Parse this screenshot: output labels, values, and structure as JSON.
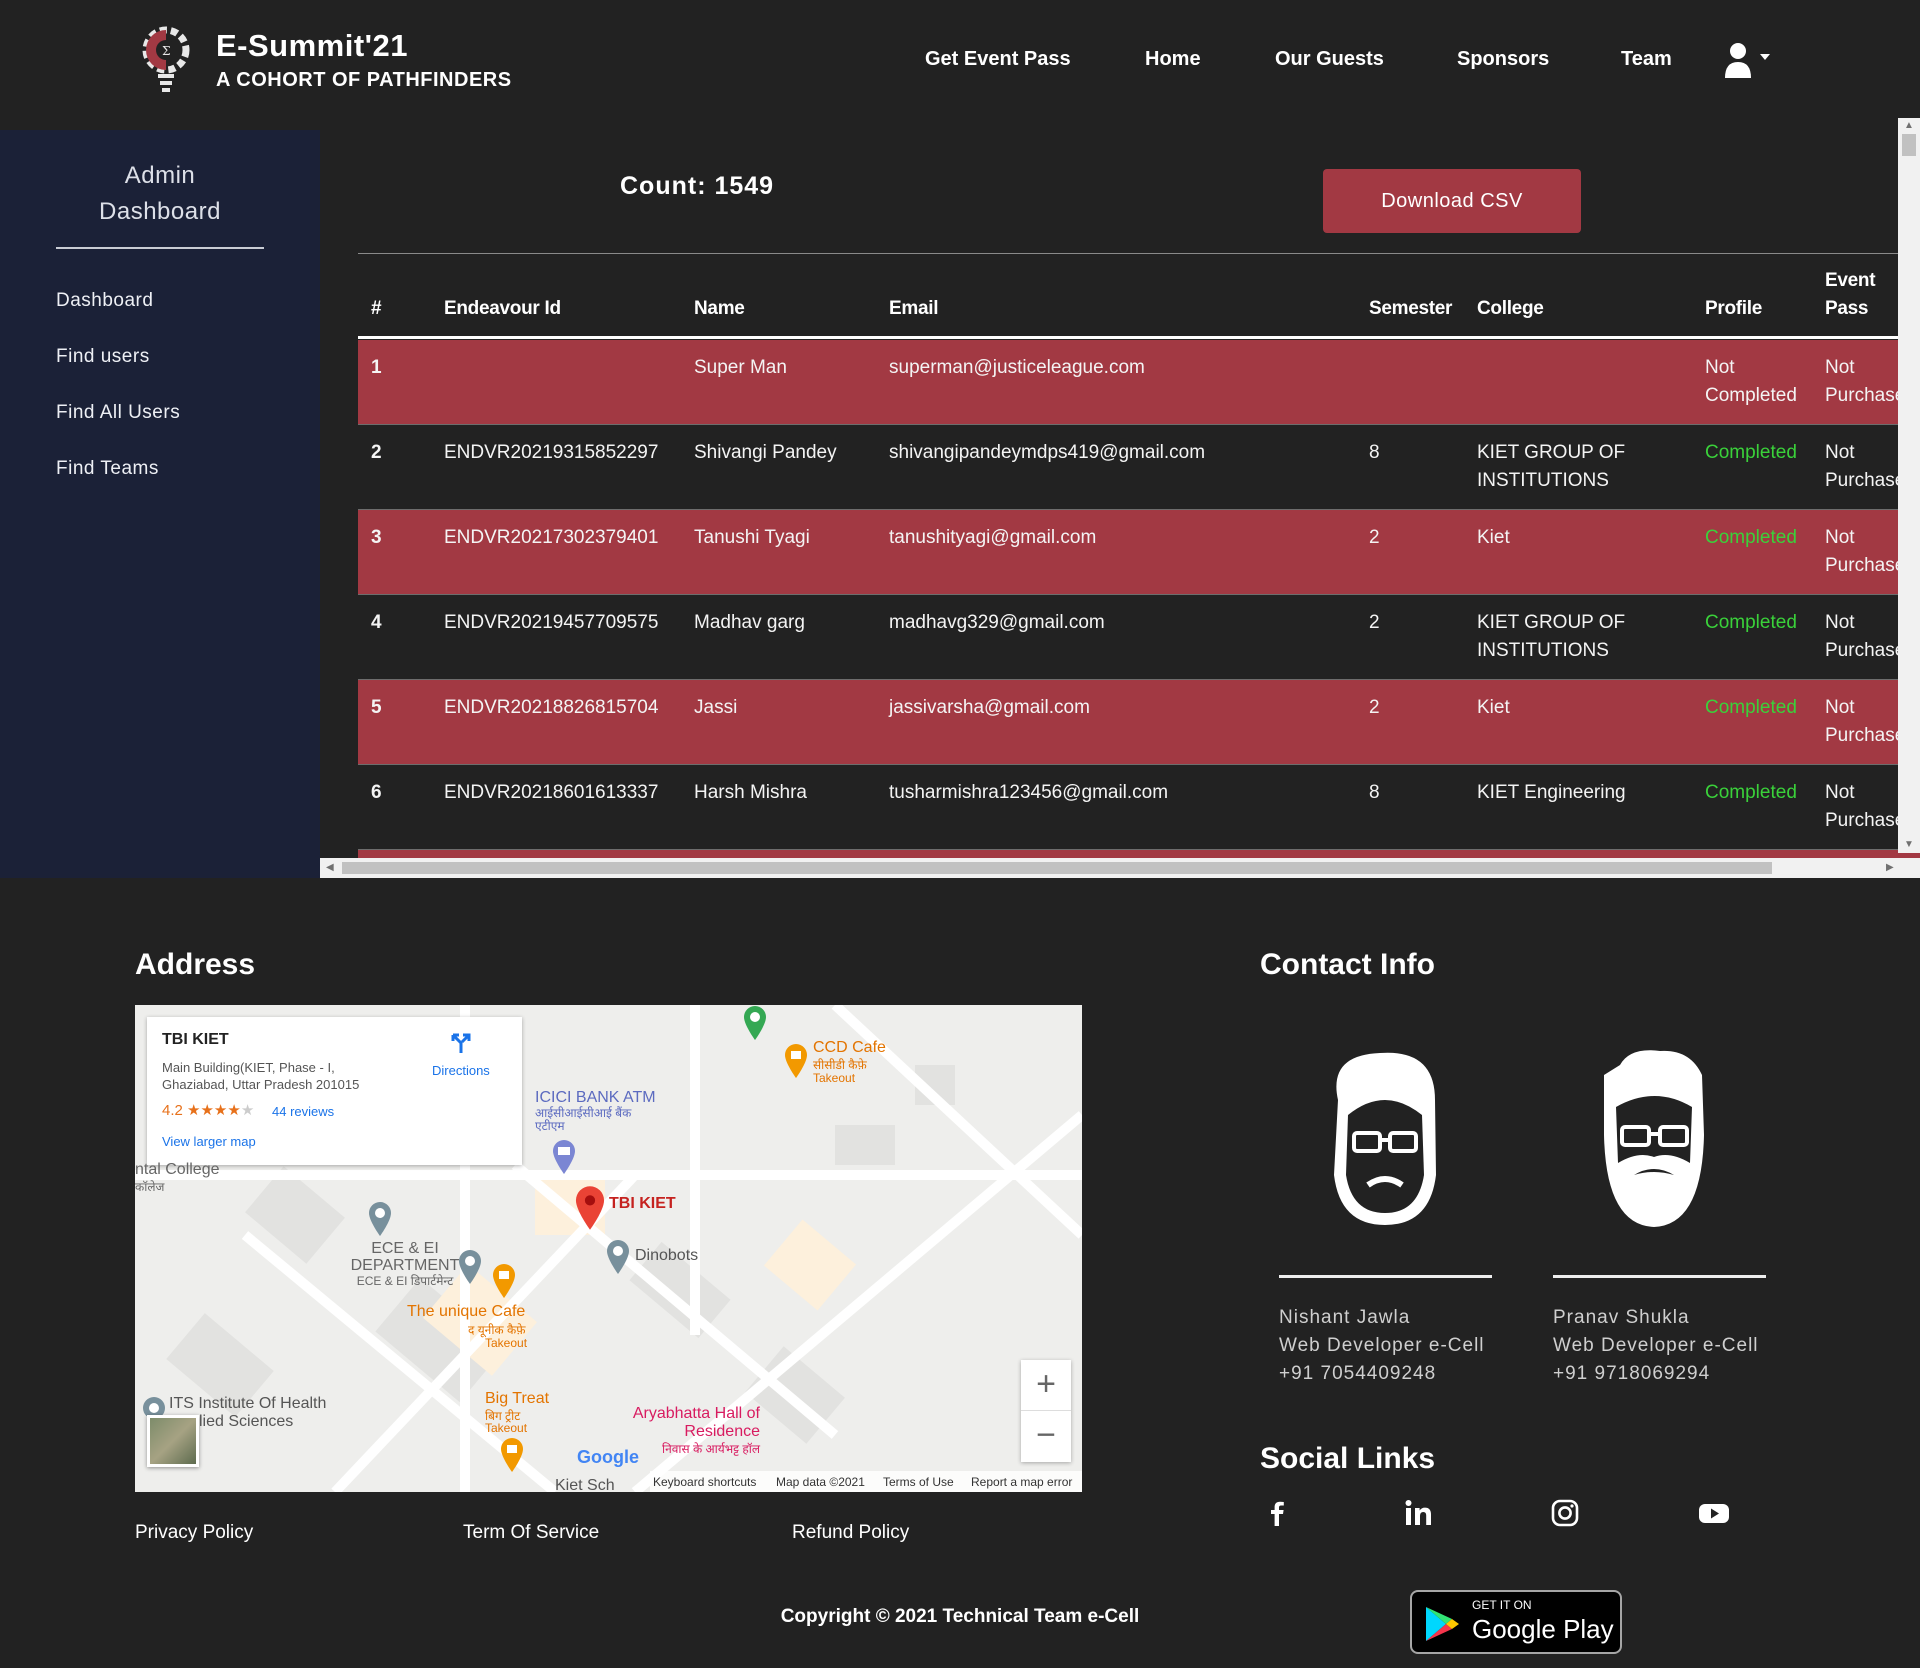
{
  "header": {
    "title": "E-Summit'21",
    "subtitle": "A COHORT OF PATHFINDERS",
    "nav": [
      "Get Event Pass",
      "Home",
      "Our Guests",
      "Sponsors",
      "Team"
    ],
    "user_icon": "user-icon"
  },
  "sidebar": {
    "title": "Admin Dashboard",
    "items": [
      "Dashboard",
      "Find users",
      "Find All Users",
      "Find Teams"
    ]
  },
  "main": {
    "count_label": "Count: 1549",
    "download_label": "Download CSV",
    "columns": [
      "#",
      "Endeavour Id",
      "Name",
      "Email",
      "Semester",
      "College",
      "Profile",
      "Event Pass"
    ],
    "rows": [
      {
        "num": "1",
        "id": "",
        "name": "Super Man",
        "email": "superman@justiceleague.com",
        "semester": "",
        "college": "",
        "profile": "Not Completed",
        "pass": "Not Purchased"
      },
      {
        "num": "2",
        "id": "ENDVR20219315852297",
        "name": "Shivangi Pandey",
        "email": "shivangipandeymdps419@gmail.com",
        "semester": "8",
        "college": "KIET GROUP OF INSTITUTIONS",
        "profile": "Completed",
        "pass": "Not Purchased"
      },
      {
        "num": "3",
        "id": "ENDVR20217302379401",
        "name": "Tanushi Tyagi",
        "email": "tanushityagi@gmail.com",
        "semester": "2",
        "college": "Kiet",
        "profile": "Completed",
        "pass": "Not Purchased"
      },
      {
        "num": "4",
        "id": "ENDVR20219457709575",
        "name": "Madhav garg",
        "email": "madhavg329@gmail.com",
        "semester": "2",
        "college": "KIET GROUP OF INSTITUTIONS",
        "profile": "Completed",
        "pass": "Not Purchased"
      },
      {
        "num": "5",
        "id": "ENDVR20218826815704",
        "name": "Jassi",
        "email": "jassivarsha@gmail.com",
        "semester": "2",
        "college": "Kiet",
        "profile": "Completed",
        "pass": "Not Purchased"
      },
      {
        "num": "6",
        "id": "ENDVR20218601613337",
        "name": "Harsh Mishra",
        "email": "tusharmishra123456@gmail.com",
        "semester": "8",
        "college": "KIET Engineering",
        "profile": "Completed",
        "pass": "Not Purchased"
      }
    ]
  },
  "footer": {
    "address_heading": "Address",
    "contact_heading": "Contact Info",
    "social_heading": "Social Links",
    "map": {
      "place": "TBI KIET",
      "address_line1": "Main Building(KIET, Phase - I,",
      "address_line2": "Ghaziabad, Uttar Pradesh 201015",
      "rating": "4.2",
      "stars": "★★★★",
      "reviews": "44 reviews",
      "larger_map": "View larger map",
      "directions": "Directions",
      "labels": {
        "ccd": "CCD Cafe",
        "ccd_hi": "सीसीडी कैफ़े",
        "takeout": "Takeout",
        "icici": "ICICI BANK ATM",
        "icici_hi": "आईसीआईसीआई बैंक एटीएम",
        "dental": "ntal College",
        "dental_hi": "कॉलेज",
        "tbi": "TBI KIET",
        "dinobots": "Dinobots",
        "ece": "ECE & EI DEPARTMENT",
        "ece_hi": "ECE & EI डिपार्टमेन्ट",
        "unique": "The unique Cafe",
        "unique_hi": "द यूनीक कैफ़े",
        "its": "ITS Institute Of Health",
        "its2": "lied Sciences",
        "bigtreat": "Big Treat",
        "bigtreat_hi": "बिग ट्रीट",
        "aryabhatta": "Aryabhatta Hall of Residence",
        "aryabhatta_hi": "निवास के आर्यभट्ट हॉल",
        "kiet_school": "Kiet Sch"
      },
      "google": "Google",
      "keyboard": "Keyboard shortcuts",
      "mapdata": "Map data ©2021",
      "terms": "Terms of Use",
      "report": "Report a map error",
      "zoom_in": "+",
      "zoom_out": "−"
    },
    "policies": [
      "Privacy Policy",
      "Term Of Service",
      "Refund Policy"
    ],
    "contacts": [
      {
        "name": "Nishant Jawla",
        "role": "Web Developer e-Cell",
        "phone": "+91 7054409248"
      },
      {
        "name": "Pranav Shukla",
        "role": "Web Developer e-Cell",
        "phone": "+91 9718069294"
      }
    ],
    "social": [
      "facebook-icon",
      "linkedin-icon",
      "instagram-icon",
      "youtube-icon"
    ],
    "copyright": "Copyright © 2021 Technical Team e-Cell",
    "gplay_small": "GET IT ON",
    "gplay_big": "Google Play"
  },
  "colors": {
    "accent": "#a23943",
    "sidebar": "#1b2137",
    "background": "#222222",
    "completed": "#3ad13a"
  }
}
